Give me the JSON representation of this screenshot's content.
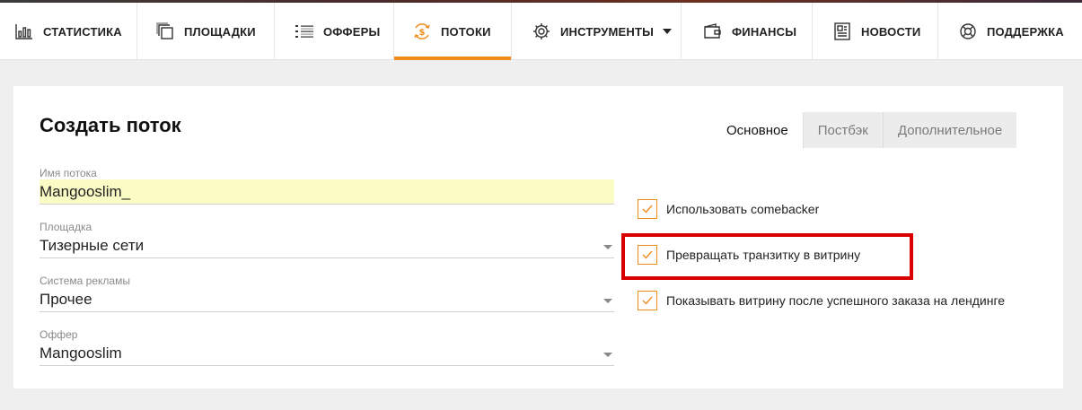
{
  "nav": {
    "items": [
      {
        "label": "СТАТИСТИКА",
        "icon": "bar-chart-icon"
      },
      {
        "label": "ПЛОЩАДКИ",
        "icon": "stacked-pages-icon"
      },
      {
        "label": "ОФФЕРЫ",
        "icon": "list-icon"
      },
      {
        "label": "ПОТОКИ",
        "icon": "money-cycle-icon",
        "active": true
      },
      {
        "label": "ИНСТРУМЕНТЫ",
        "icon": "gear-icon",
        "has_dropdown": true
      },
      {
        "label": "ФИНАНСЫ",
        "icon": "wallet-icon"
      },
      {
        "label": "НОВОСТИ",
        "icon": "newspaper-icon"
      },
      {
        "label": "ПОДДЕРЖКА",
        "icon": "lifebuoy-icon"
      }
    ]
  },
  "form": {
    "title": "Создать поток",
    "tabs": [
      "Основное",
      "Постбэк",
      "Дополнительное"
    ],
    "active_tab": "Основное",
    "fields": {
      "stream_name": {
        "label": "Имя потока",
        "value": "Mangooslim_"
      },
      "platform": {
        "label": "Площадка",
        "value": "Тизерные сети"
      },
      "ad_system": {
        "label": "Система рекламы",
        "value": "Прочее"
      },
      "offer": {
        "label": "Оффер",
        "value": "Mangooslim"
      }
    },
    "checkboxes": [
      {
        "label": "Использовать comebacker",
        "checked": true
      },
      {
        "label": "Превращать транзитку в витрину",
        "checked": true,
        "highlighted": true
      },
      {
        "label": "Показывать витрину после успешного заказа на лендинге",
        "checked": true
      }
    ]
  },
  "colors": {
    "accent": "#f08c1e",
    "highlight_border": "#d90000",
    "input_background": "#fbfbc6"
  }
}
